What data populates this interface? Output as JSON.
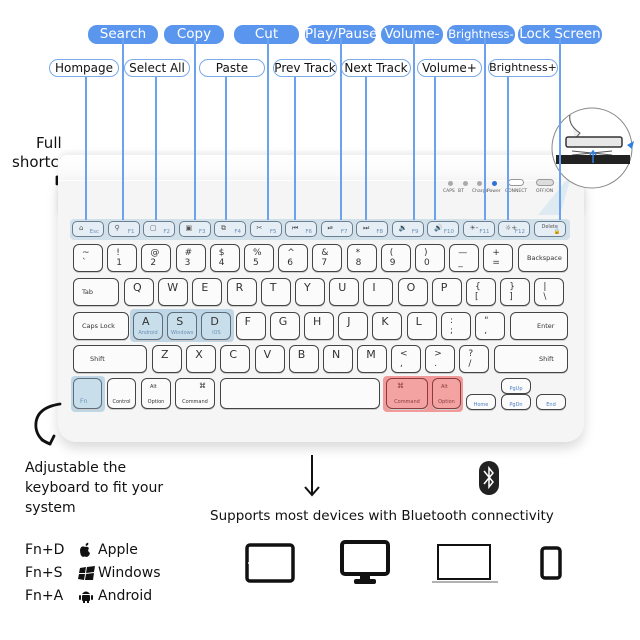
{
  "callouts": {
    "top_row": [
      "Search",
      "Copy",
      "Cut",
      "Play/Pause",
      "Volume-",
      "Brightness-",
      "Lock Screen"
    ],
    "second_row": [
      "Hompage",
      "Select All",
      "Paste",
      "Prev Track",
      "Next Track",
      "Volume+",
      "Brightness+"
    ]
  },
  "full_shortcuts_label": [
    "Full",
    "shortcuts"
  ],
  "indicators": {
    "leds": [
      "CAPS",
      "BT",
      "Charge",
      "Power"
    ],
    "connect": "CONNECT",
    "power_switch": "OFF/ON"
  },
  "keyboard": {
    "fn_row": [
      {
        "icon": "⌂",
        "label": "Esc"
      },
      {
        "icon": "⚲",
        "label": "F1"
      },
      {
        "icon": "▢",
        "label": "F2"
      },
      {
        "icon": "▣",
        "label": "F3"
      },
      {
        "icon": "⧉",
        "label": "F4"
      },
      {
        "icon": "✂",
        "label": "F5"
      },
      {
        "icon": "⏮",
        "label": "F6"
      },
      {
        "icon": "⏯",
        "label": "F7"
      },
      {
        "icon": "⏭",
        "label": "F8"
      },
      {
        "icon": "🔉",
        "label": "F9"
      },
      {
        "icon": "🔊",
        "label": "F10"
      },
      {
        "icon": "☀-",
        "label": "F11"
      },
      {
        "icon": "☼+",
        "label": "F12"
      },
      {
        "icon": "Delete",
        "label": "🔒"
      }
    ],
    "number_row": [
      {
        "top": "~",
        "bottom": "`"
      },
      {
        "top": "!",
        "bottom": "1"
      },
      {
        "top": "@",
        "bottom": "2"
      },
      {
        "top": "#",
        "bottom": "3"
      },
      {
        "top": "$",
        "bottom": "4"
      },
      {
        "top": "%",
        "bottom": "5"
      },
      {
        "top": "^",
        "bottom": "6"
      },
      {
        "top": "&",
        "bottom": "7"
      },
      {
        "top": "*",
        "bottom": "8"
      },
      {
        "top": "(",
        "bottom": "9"
      },
      {
        "top": ")",
        "bottom": "0"
      },
      {
        "top": "—",
        "bottom": "_"
      },
      {
        "top": "+",
        "bottom": "="
      }
    ],
    "backspace": "Backspace",
    "tab": "Tab",
    "qwerty": [
      "Q",
      "W",
      "E",
      "R",
      "T",
      "Y",
      "U",
      "I",
      "O",
      "P"
    ],
    "brackets": [
      {
        "top": "{",
        "bottom": "["
      },
      {
        "top": "}",
        "bottom": "]"
      },
      {
        "top": "|",
        "bottom": "\\"
      }
    ],
    "caps": "Caps Lock",
    "home_row": [
      "A",
      "S",
      "D",
      "F",
      "G",
      "H",
      "J",
      "K",
      "L"
    ],
    "home_row_sub": {
      "A": "Android",
      "S": "Windows",
      "D": "iOS"
    },
    "home_punct": [
      {
        "top": ":",
        "bottom": ";"
      },
      {
        "top": "\"",
        "bottom": ","
      }
    ],
    "enter": "Enter",
    "shift": "Shift",
    "bottom_letters": [
      "Z",
      "X",
      "C",
      "V",
      "B",
      "N",
      "M"
    ],
    "bottom_punct": [
      {
        "top": "<",
        "bottom": ","
      },
      {
        "top": ">",
        "bottom": "."
      },
      {
        "top": "?",
        "bottom": "/"
      }
    ],
    "mods": {
      "fn": "Fn",
      "control": "Control",
      "alt": "Alt",
      "option": "Option",
      "cmd_symbol": "⌘",
      "command": "Command",
      "home": "Home",
      "pgup": "PgUp",
      "pgdn": "PgDn",
      "end": "End"
    }
  },
  "adjust_text": [
    "Adjustable the",
    "keyboard to fit your",
    "system"
  ],
  "os_shortcuts": [
    {
      "combo": "Fn+D",
      "icon": "apple-icon",
      "os": "Apple"
    },
    {
      "combo": "Fn+S",
      "icon": "windows-icon",
      "os": "Windows"
    },
    {
      "combo": "Fn+A",
      "icon": "android-icon",
      "os": "Android"
    }
  ],
  "bluetooth_text": "Supports most devices with Bluetooth connectivity",
  "devices": [
    "tablet",
    "monitor",
    "laptop",
    "phone"
  ],
  "colors": {
    "accent": "#5a96ee",
    "highlight_blue": "#c9deeb",
    "highlight_red": "#f4a3a3"
  }
}
